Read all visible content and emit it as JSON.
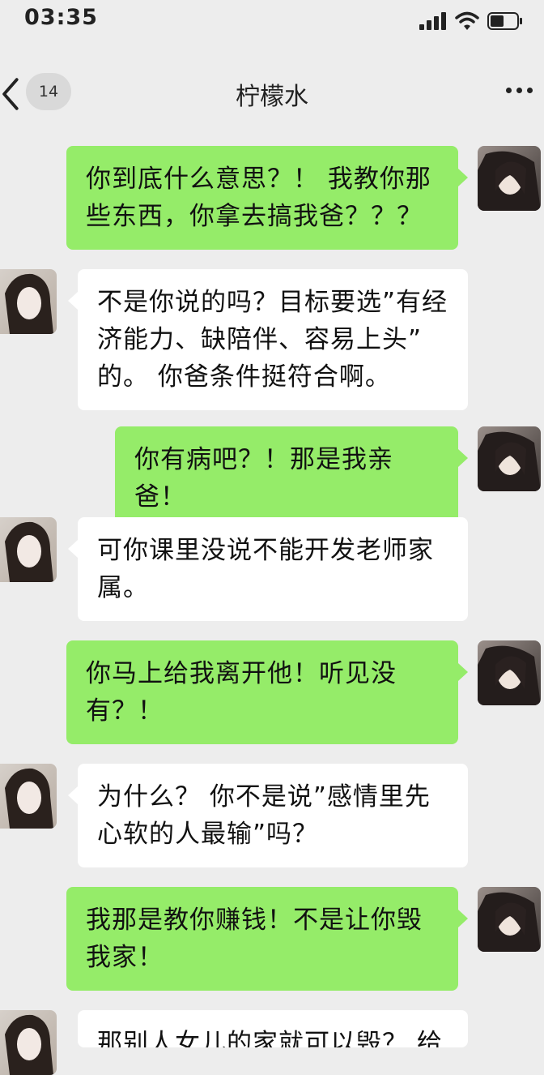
{
  "status_bar": {
    "time": "03:35",
    "icons": [
      "signal-icon",
      "wifi-icon",
      "battery-icon"
    ]
  },
  "header": {
    "back_icon": "chevron-left-icon",
    "unread_count": "14",
    "title": "柠檬水",
    "more_icon": "more-dots-icon"
  },
  "messages": [
    {
      "side": "out",
      "text": "你到底什么意思？！ 我教你那些东西，你拿去搞我爸？？？"
    },
    {
      "side": "in",
      "text": "不是你说的吗？目标要选”有经济能力、缺陪伴、容易上头” 的。 你爸条件挺符合啊。"
    },
    {
      "side": "out",
      "text": "你有病吧？！那是我亲爸！"
    },
    {
      "side": "in",
      "text": "可你课里没说不能开发老师家属。"
    },
    {
      "side": "out",
      "text": "你马上给我离开他！听见没有？！"
    },
    {
      "side": "in",
      "text": "为什么？ 你不是说”感情里先心软的人最输”吗？"
    },
    {
      "side": "out",
      "text": "我那是教你赚钱！不是让你毁我家！"
    },
    {
      "side": "in",
      "text": "那别人女儿的家就可以毁？ 给"
    }
  ],
  "colors": {
    "outgoing_bubble": "#95ec69",
    "incoming_bubble": "#ffffff",
    "background": "#ededed"
  }
}
